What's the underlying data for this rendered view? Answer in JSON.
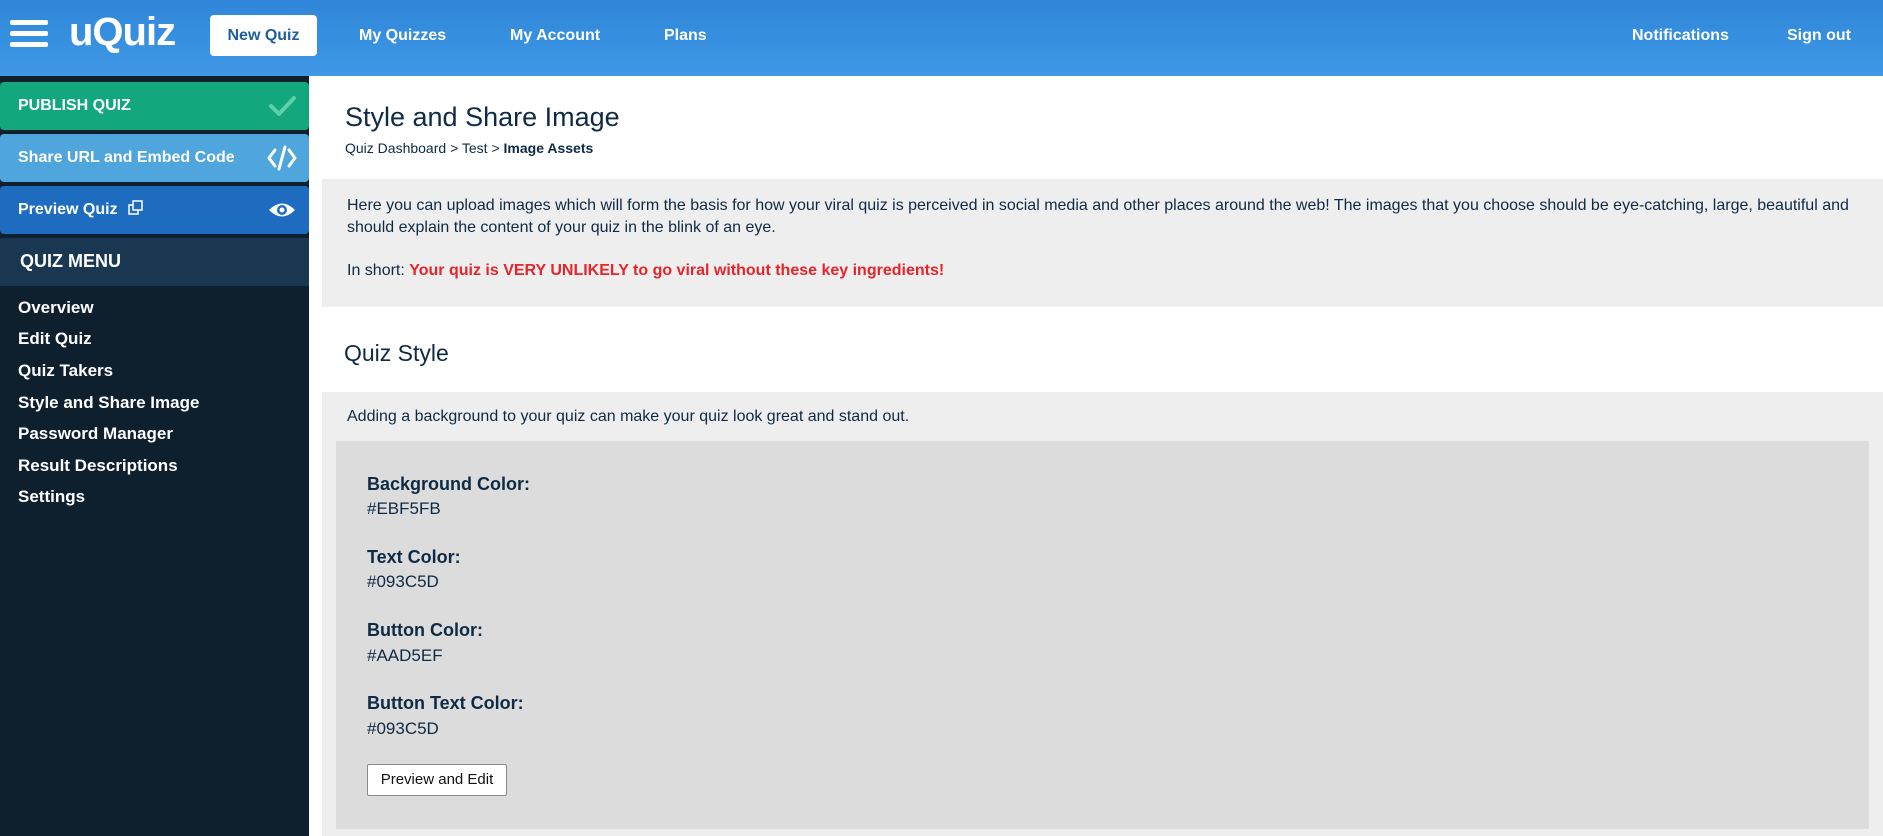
{
  "header": {
    "logo": "uQuiz",
    "nav": {
      "new_quiz": "New Quiz",
      "my_quizzes": "My Quizzes",
      "my_account": "My Account",
      "plans": "Plans",
      "notifications": "Notifications",
      "sign_out": "Sign out"
    }
  },
  "sidebar": {
    "publish": "PUBLISH QUIZ",
    "share": "Share URL and Embed Code",
    "preview": "Preview Quiz",
    "menu_title": "QUIZ MENU",
    "items": [
      {
        "label": "Overview"
      },
      {
        "label": "Edit Quiz"
      },
      {
        "label": "Quiz Takers"
      },
      {
        "label": "Style and Share Image"
      },
      {
        "label": "Password Manager"
      },
      {
        "label": "Result Descriptions"
      },
      {
        "label": "Settings"
      }
    ]
  },
  "main": {
    "title": "Style and Share Image",
    "breadcrumb": {
      "dashboard": "Quiz Dashboard",
      "sep": ">",
      "quiz": "Test",
      "current": "Image Assets"
    },
    "intro": "Here you can upload images which will form the basis for how your viral quiz is perceived in social media and other places around the web! The images that you choose should be eye-catching, large, beautiful and should explain the content of your quiz in the blink of an eye.",
    "in_short_label": "In short:",
    "in_short_warning": "Your quiz is VERY UNLIKELY to go viral without these key ingredients!",
    "quiz_style": {
      "title": "Quiz Style",
      "description": "Adding a background to your quiz can make your quiz look great and stand out.",
      "fields": [
        {
          "label": "Background Color:",
          "value": "#EBF5FB"
        },
        {
          "label": "Text Color:",
          "value": "#093C5D"
        },
        {
          "label": "Button Color:",
          "value": "#AAD5EF"
        },
        {
          "label": "Button Text Color:",
          "value": "#093C5D"
        }
      ],
      "button": "Preview and Edit"
    }
  },
  "colors": {
    "header_blue": "#3f98e6",
    "publish_green": "#12a77c",
    "share_blue": "#4fa6dc",
    "preview_blue": "#1e6cbf",
    "sidebar_dark": "#0e1f2e",
    "warning_red": "#e8242b"
  }
}
